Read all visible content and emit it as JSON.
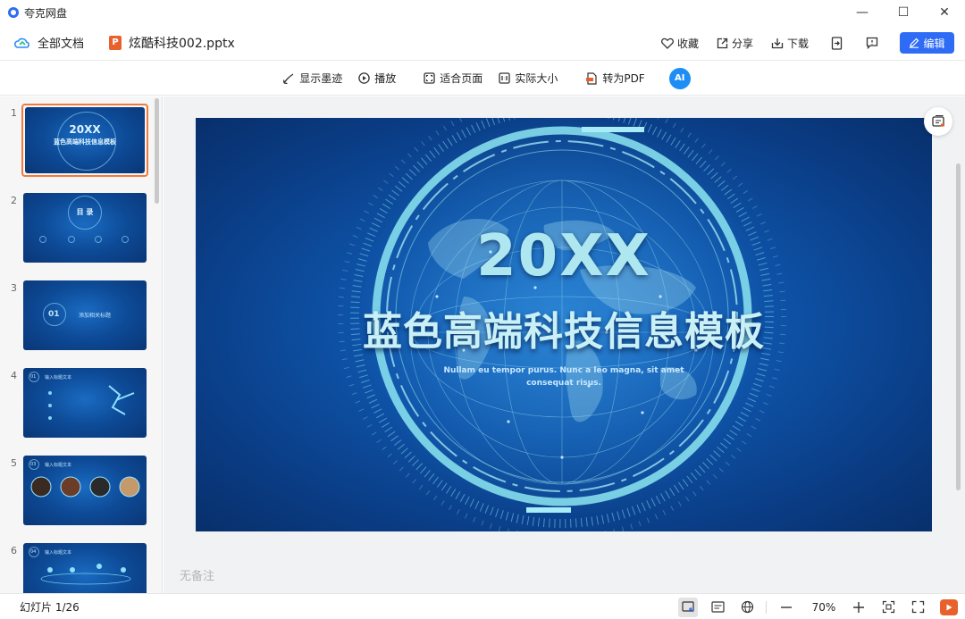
{
  "app": {
    "name": "夸克网盘"
  },
  "window_controls": {
    "minimize": "—",
    "maximize": "☐",
    "close": "✕"
  },
  "header": {
    "all_docs": "全部文档",
    "file_badge": "P",
    "file_name": "炫酷科技002.pptx",
    "favorite": "收藏",
    "share": "分享",
    "download": "下载",
    "edit": "编辑"
  },
  "toolbar": {
    "show_ink": "显示墨迹",
    "play": "播放",
    "fit_page": "适合页面",
    "actual_size": "实际大小",
    "to_pdf": "转为PDF",
    "ai_label": "AI"
  },
  "thumbnails": [
    {
      "num": "1",
      "title": "20XX",
      "subtitle": "蓝色高端科技信息模板"
    },
    {
      "num": "2",
      "title": "目 录"
    },
    {
      "num": "3",
      "badge": "01",
      "title": "添加相关标题"
    },
    {
      "num": "4",
      "badge": "01",
      "title": "输入标题文本"
    },
    {
      "num": "5",
      "badge": "03",
      "title": "输入标题文本"
    },
    {
      "num": "6",
      "badge": "04",
      "title": "输入标题文本"
    }
  ],
  "slide": {
    "year": "20XX",
    "title": "蓝色高端科技信息模板",
    "sub_line1": "Nullam eu tempor purus. Nunc a leo magna, sit amet",
    "sub_line2": "consequat risus."
  },
  "notes": "无备注",
  "status": {
    "slide_count": "幻灯片 1/26",
    "zoom": "70%"
  }
}
